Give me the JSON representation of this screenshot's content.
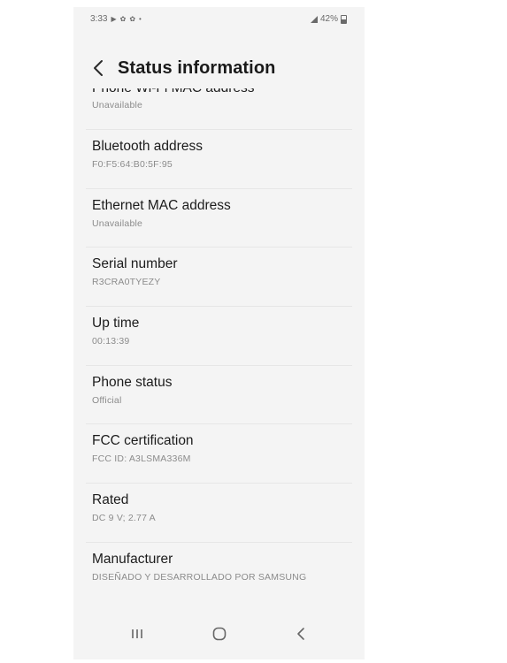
{
  "status_bar": {
    "time": "3:33",
    "battery": "42%",
    "icons_left": [
      "play-icon",
      "settings-icon",
      "settings-icon",
      "dot-icon"
    ],
    "icons_right": [
      "signal-icon",
      "battery-icon"
    ]
  },
  "header": {
    "title": "Status information",
    "back_icon": "chevron-left-icon"
  },
  "items": [
    {
      "title": "Phone Wi-Fi MAC address",
      "value": "Unavailable"
    },
    {
      "title": "Bluetooth address",
      "value": "F0:F5:64:B0:5F:95"
    },
    {
      "title": "Ethernet MAC address",
      "value": "Unavailable"
    },
    {
      "title": "Serial number",
      "value": "R3CRA0TYEZY"
    },
    {
      "title": "Up time",
      "value": "00:13:39"
    },
    {
      "title": "Phone status",
      "value": "Official"
    },
    {
      "title": "FCC certification",
      "value": "FCC ID: A3LSMA336M"
    },
    {
      "title": "Rated",
      "value": "DC 9 V; 2.77 A"
    },
    {
      "title": "Manufacturer",
      "value": "DISEÑADO Y DESARROLLADO POR SAMSUNG"
    }
  ],
  "nav_bar": {
    "recents_icon": "recents-icon",
    "home_icon": "home-icon",
    "back_icon": "back-icon"
  }
}
